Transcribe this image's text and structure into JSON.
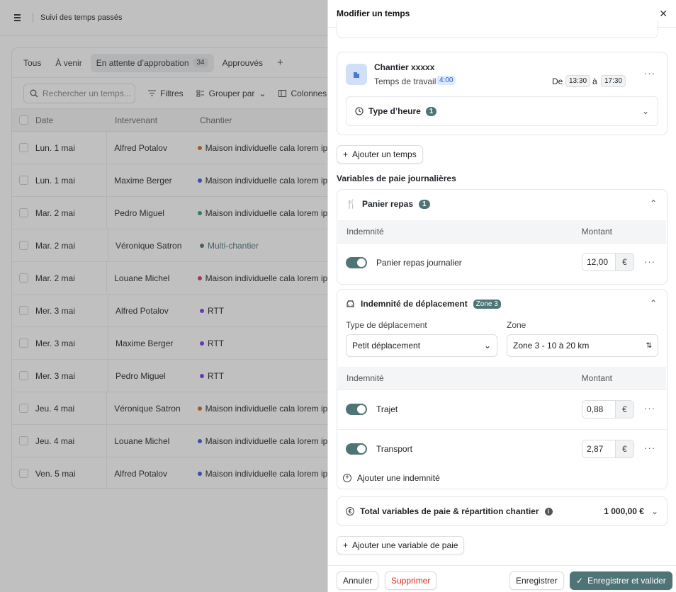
{
  "topbar": {
    "title": "Suivi des temps passés"
  },
  "tabs": [
    {
      "label": "Tous"
    },
    {
      "label": "À venir"
    },
    {
      "label": "En attente d’approbation",
      "count": "34"
    },
    {
      "label": "Approuvés"
    }
  ],
  "toolbar": {
    "search_placeholder": "Rechercher un temps...",
    "filters": "Filtres",
    "group": "Grouper par",
    "columns": "Colonnes"
  },
  "table": {
    "headers": [
      "Date",
      "Intervenant",
      "Chantier"
    ],
    "rows": [
      {
        "date": "Lun. 1 mai",
        "person": "Alfred Potalov",
        "site": "Maison individuelle cala lorem ipsum",
        "color": "#d2691e"
      },
      {
        "date": "Lun. 1 mai",
        "person": "Maxime Berger",
        "site": "Maison individuelle cala lorem ipsum",
        "color": "#3b5bdb"
      },
      {
        "date": "Mar. 2 mai",
        "person": "Pedro Miguel",
        "site": "Maison individuelle cala lorem ipsum",
        "color": "#2f9e74"
      },
      {
        "date": "Mar. 2 mai",
        "person": "Véronique Satron",
        "site": "Multi-chantier",
        "color": "#4f7476"
      },
      {
        "date": "Mar. 2 mai",
        "person": "Louane Michel",
        "site": "Maison individuelle cala lorem ipsum",
        "color": "#d6336c"
      },
      {
        "date": "Mer. 3 mai",
        "person": "Alfred Potalov",
        "site": "RTT",
        "color": "#7c3aed"
      },
      {
        "date": "Mer. 3 mai",
        "person": "Maxime Berger",
        "site": "RTT",
        "color": "#7c3aed"
      },
      {
        "date": "Mer. 3 mai",
        "person": "Pedro Miguel",
        "site": "RTT",
        "color": "#7c3aed"
      },
      {
        "date": "Jeu. 4 mai",
        "person": "Véronique Satron",
        "site": "Maison individuelle cala lorem ipsum",
        "color": "#d2691e"
      },
      {
        "date": "Jeu. 4 mai",
        "person": "Louane Michel",
        "site": "Maison individuelle cala lorem ipsum",
        "color": "#3b5bdb"
      },
      {
        "date": "Ven. 5 mai",
        "person": "Alfred Potalov",
        "site": "Maison individuelle cala lorem ipsum",
        "color": "#3b5bdb"
      }
    ]
  },
  "panel": {
    "title": "Modifier un temps",
    "entry": {
      "site": "Chantier xxxxx",
      "work_label": "Temps de travail",
      "work_value": "4:00",
      "from_label": "De",
      "from": "13:30",
      "to_label": "à",
      "to": "17:30",
      "hour_type": "Type d’heure",
      "hour_type_count": "1"
    },
    "add_time": "Ajouter un temps",
    "section_title": "Variables de paie journalières",
    "meal": {
      "title": "Panier repas",
      "count": "1",
      "col1": "Indemnité",
      "col2": "Montant",
      "item": "Panier repas journalier",
      "amount": "12,00",
      "unit": "€"
    },
    "travel": {
      "title": "Indemnité de déplacement",
      "zone_badge": "Zone 3",
      "type_label": "Type de déplacement",
      "type_value": "Petit déplacement",
      "zone_label": "Zone",
      "zone_value": "Zone 3 - 10 à 20 km",
      "col1": "Indemnité",
      "col2": "Montant",
      "items": [
        {
          "label": "Trajet",
          "amount": "0,88",
          "unit": "€"
        },
        {
          "label": "Transport",
          "amount": "2,87",
          "unit": "€"
        }
      ],
      "add": "Ajouter une indemnité"
    },
    "total": {
      "label": "Total variables de paie & répartition chantier",
      "value": "1 000,00 €"
    },
    "add_variable": "Ajouter une variable de paie",
    "footer": {
      "cancel": "Annuler",
      "delete": "Supprimer",
      "save": "Enregistrer",
      "save_validate": "Enregistrer et valider"
    }
  },
  "colors": {
    "accent": "#4f7476",
    "danger": "#d93025",
    "chip_blue": "#dbeafe"
  }
}
